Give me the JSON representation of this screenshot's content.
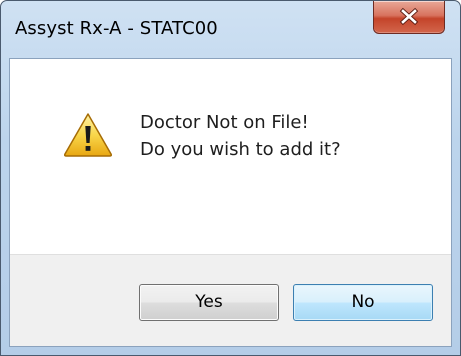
{
  "window": {
    "title": "Assyst Rx-A - STATC00"
  },
  "message": {
    "line1": "Doctor Not on File!",
    "line2": "Do you wish to add it?",
    "icon": "warning-icon"
  },
  "buttons": {
    "yes_label": "Yes",
    "no_label": "No",
    "default": "No"
  },
  "colors": {
    "close_button": "#c4442a",
    "title_bar": "#bcd4ec",
    "default_button_border": "#3c7fb1"
  }
}
